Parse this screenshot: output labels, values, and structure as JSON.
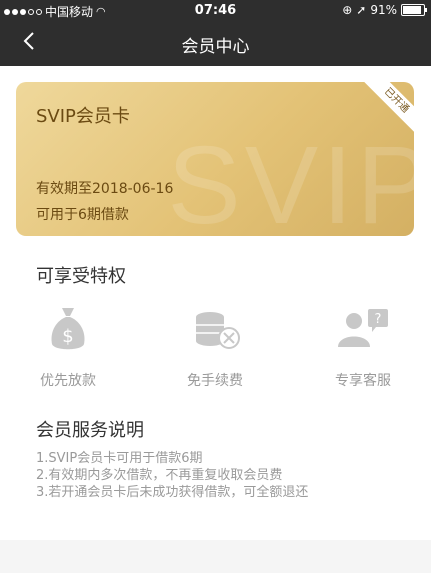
{
  "status_bar": {
    "carrier": "中国移动",
    "time": "07:46",
    "battery": "91%",
    "battery_level": 0.91
  },
  "nav": {
    "title": "会员中心"
  },
  "card": {
    "title": "SVIP会员卡",
    "badge": "已开通",
    "watermark": "SVIP",
    "valid_until": "有效期至2018-06-16",
    "usage": "可用于6期借款"
  },
  "privileges": {
    "title": "可享受特权",
    "items": [
      {
        "label": "优先放款",
        "icon": "money-bag-icon"
      },
      {
        "label": "免手续费",
        "icon": "coins-no-fee-icon"
      },
      {
        "label": "专享客服",
        "icon": "customer-service-icon"
      }
    ]
  },
  "service": {
    "title": "会员服务说明",
    "lines": [
      "1.SVIP会员卡可用于借款6期",
      "2.有效期内多次借款，不再重复收取会员费",
      "3.若开通会员卡后未成功获得借款，可全额退还"
    ]
  },
  "colors": {
    "header": "#2e2e2e",
    "card_gold": "#e3c276",
    "card_text": "#6b4a12",
    "muted": "#9a9a9a",
    "icon_gray": "#c8c8c8"
  }
}
